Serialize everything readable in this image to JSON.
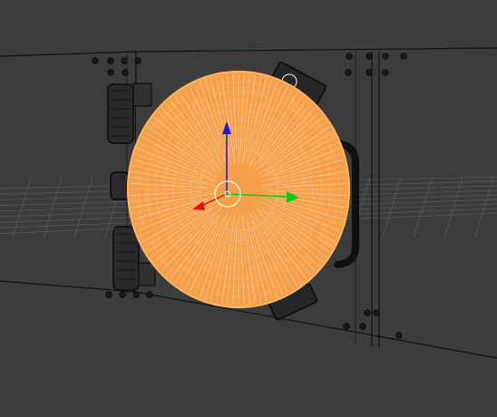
{
  "viewport": {
    "background": "#3c3c3c",
    "grid_color": "#5c5c5c",
    "wire_color": "#0c0c0c",
    "selection_color": "#f5a04a",
    "selection_wire_color": "#ffffff"
  },
  "gizmo": {
    "x_axis_color": "#e01010",
    "y_axis_color": "#10c810",
    "z_axis_color": "#1818e0",
    "center_color": "#ffffff"
  },
  "scene": {
    "selected_object": "disc-mesh",
    "objects": [
      "panel-frame",
      "disc-mesh",
      "handle",
      "hinge-top",
      "hinge-bottom",
      "latch-top",
      "latch-bottom"
    ]
  }
}
